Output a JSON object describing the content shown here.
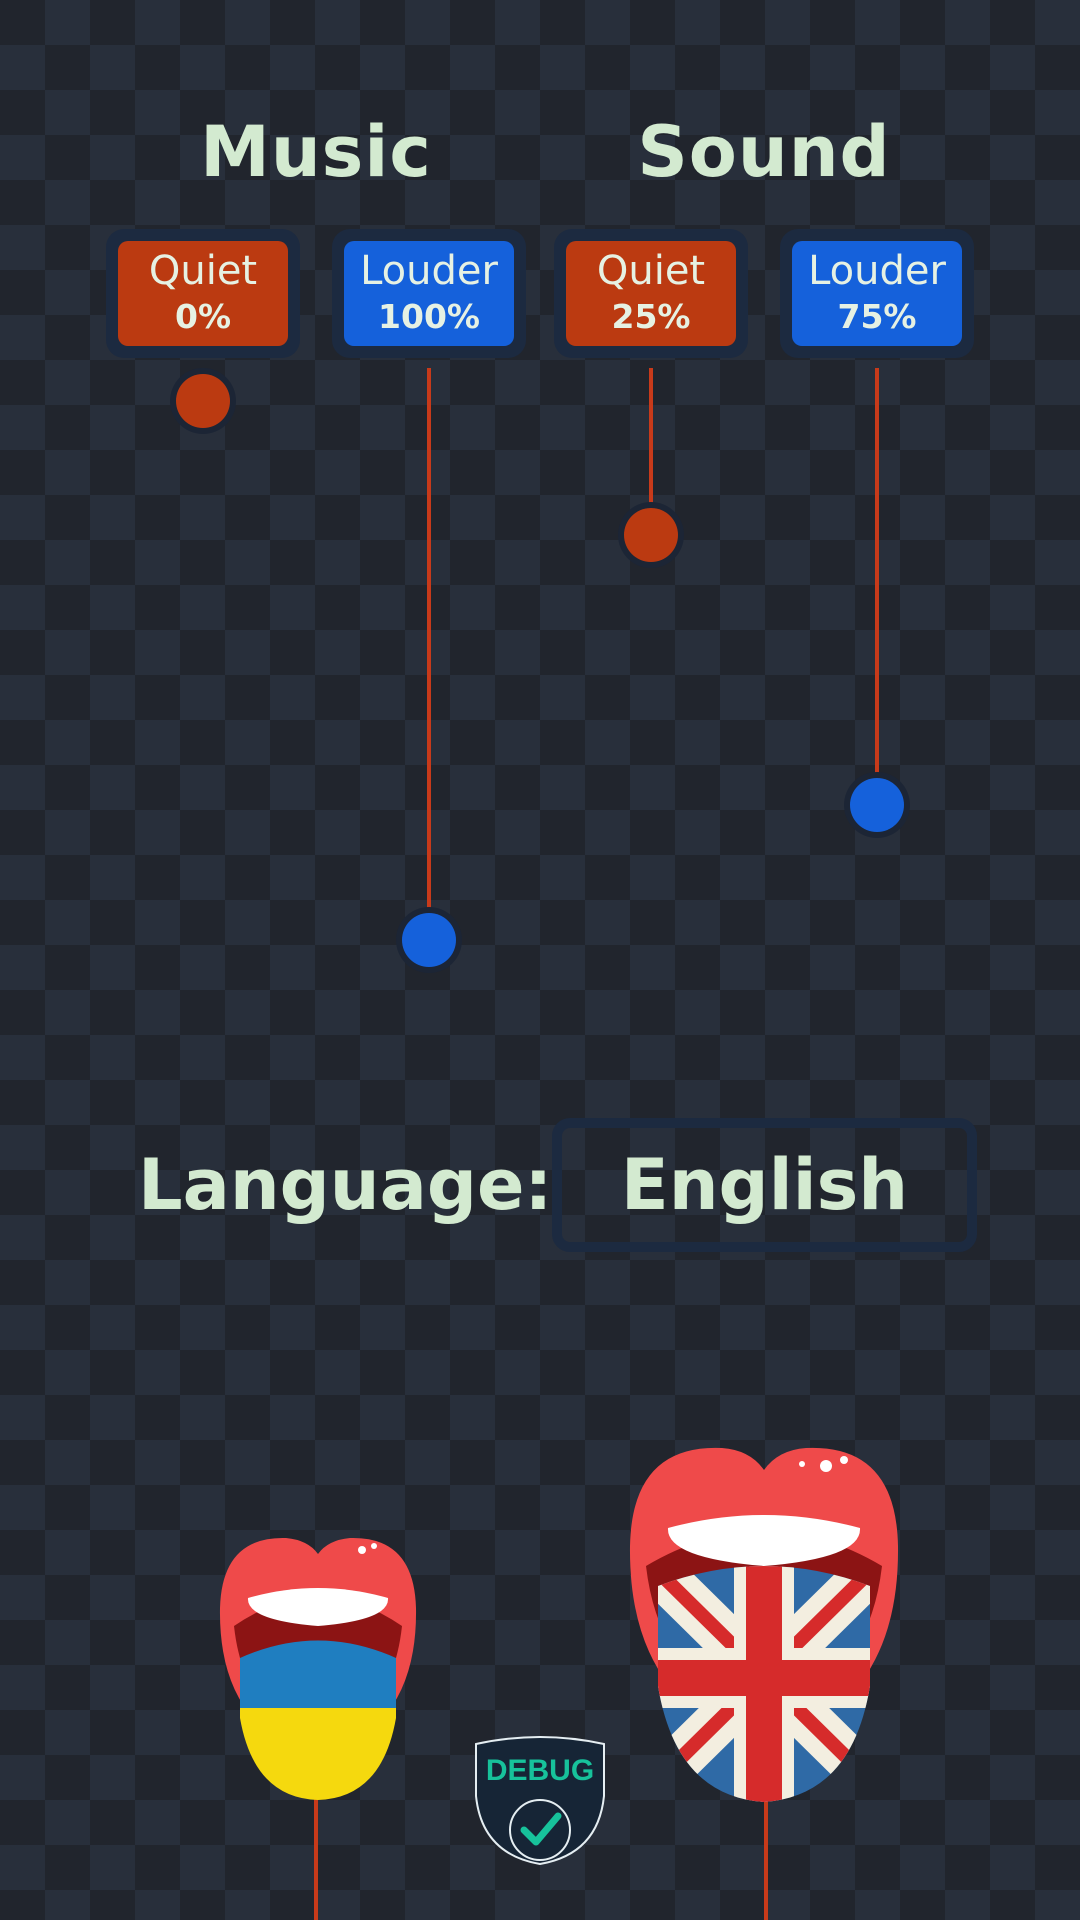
{
  "sections": {
    "music": {
      "title": "Music"
    },
    "sound": {
      "title": "Sound"
    }
  },
  "volume": {
    "music_quiet": {
      "label": "Quiet",
      "value": "0%"
    },
    "music_louder": {
      "label": "Louder",
      "value": "100%"
    },
    "sound_quiet": {
      "label": "Quiet",
      "value": "25%"
    },
    "sound_louder": {
      "label": "Louder",
      "value": "75%"
    }
  },
  "language": {
    "label": "Language:",
    "selected": "English",
    "options_icons": [
      "ukrainian-tongue-icon",
      "english-tongue-icon"
    ]
  },
  "debug": {
    "label": "DEBUG"
  },
  "colors": {
    "quiet": "#bb3a11",
    "louder": "#1561db",
    "heading_text": "#d3ead0",
    "panel": "#1c2a40"
  }
}
